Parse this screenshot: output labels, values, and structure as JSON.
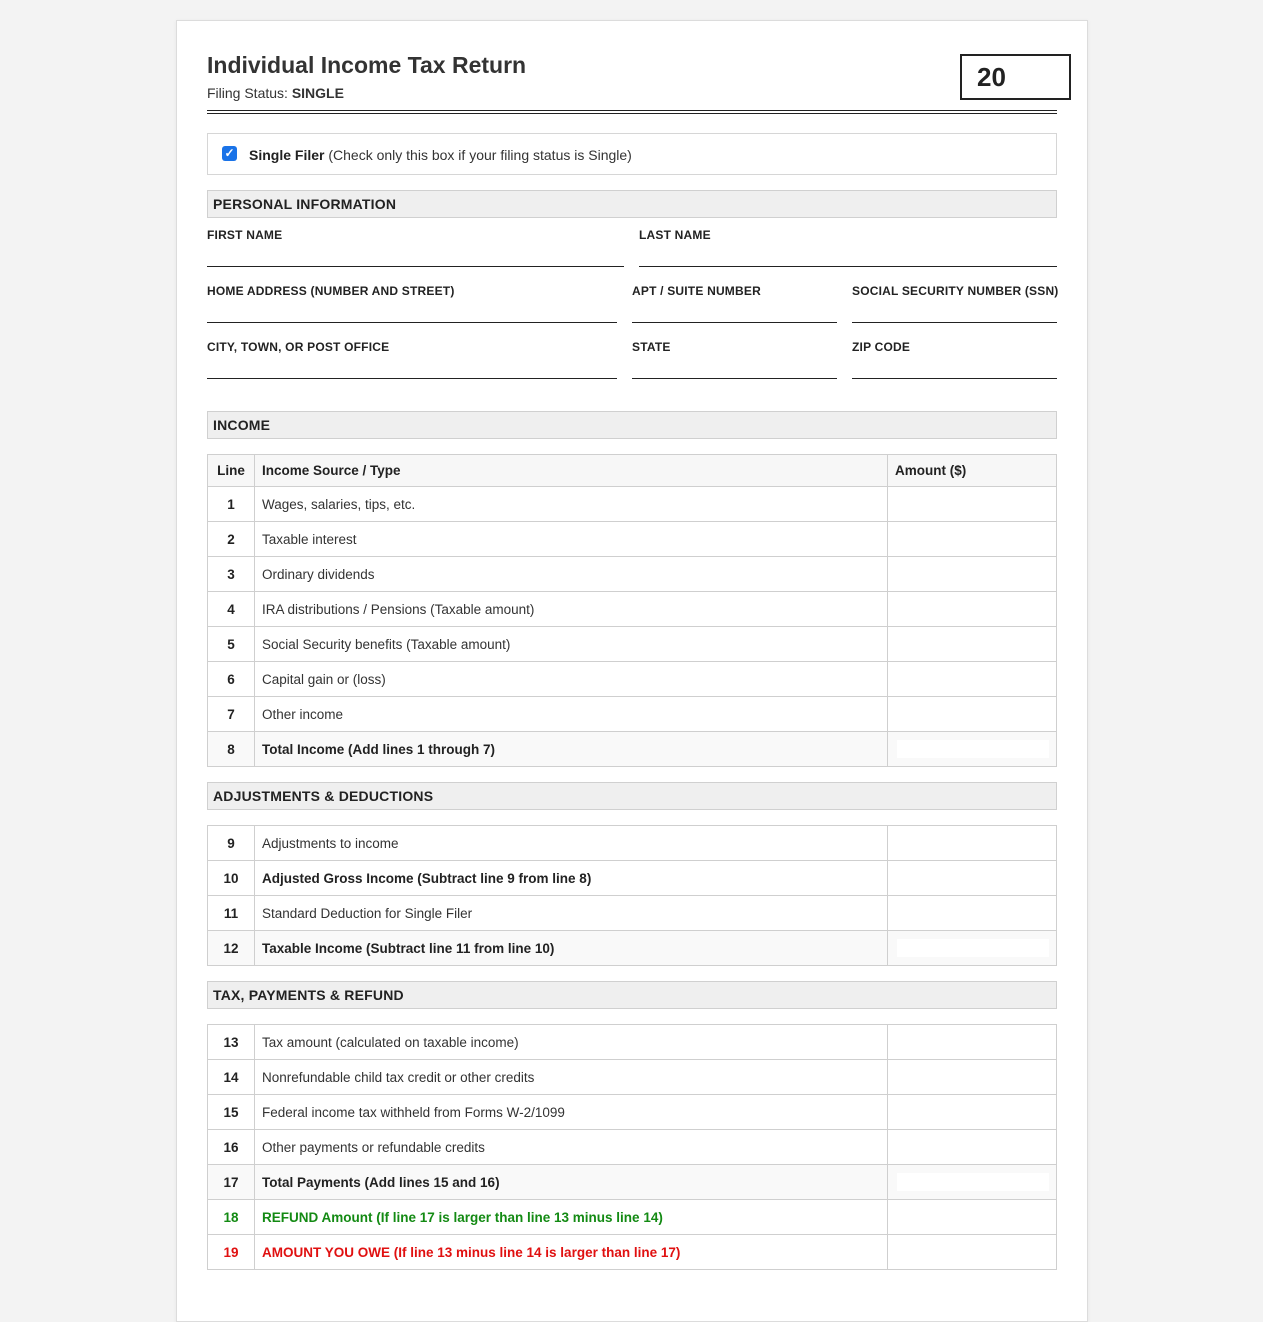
{
  "header": {
    "title": "Individual Income Tax Return",
    "filing_status_label": "Filing Status:",
    "filing_status_value": "SINGLE",
    "year": "20"
  },
  "filer": {
    "checked": true,
    "label_bold": "Single Filer",
    "label_note": "(Check only this box if your filing status is Single)"
  },
  "sections": {
    "personal": "PERSONAL INFORMATION",
    "income": "INCOME",
    "adjustments": "ADJUSTMENTS & DEDUCTIONS",
    "tax": "TAX, PAYMENTS & REFUND"
  },
  "personal_fields": {
    "first_name": "FIRST NAME",
    "last_name": "LAST NAME",
    "home_address": "HOME ADDRESS (NUMBER AND STREET)",
    "apt": "APT / SUITE NUMBER",
    "ssn": "SOCIAL SECURITY NUMBER (SSN)",
    "city": "CITY, TOWN, OR POST OFFICE",
    "state": "STATE",
    "zip": "ZIP CODE"
  },
  "income_table": {
    "headers": [
      "Line",
      "Income Source / Type",
      "Amount ($)"
    ],
    "rows": [
      {
        "line": "1",
        "desc": "Wages, salaries, tips, etc."
      },
      {
        "line": "2",
        "desc": "Taxable interest"
      },
      {
        "line": "3",
        "desc": "Ordinary dividends"
      },
      {
        "line": "4",
        "desc": "IRA distributions / Pensions (Taxable amount)"
      },
      {
        "line": "5",
        "desc": "Social Security benefits (Taxable amount)"
      },
      {
        "line": "6",
        "desc": "Capital gain or (loss)"
      },
      {
        "line": "7",
        "desc": "Other income"
      },
      {
        "line": "8",
        "desc": "Total Income (Add lines 1 through 7)"
      }
    ]
  },
  "adjust_table": {
    "rows": [
      {
        "line": "9",
        "desc": "Adjustments to income"
      },
      {
        "line": "10",
        "desc": "Adjusted Gross Income (Subtract line 9 from line 8)"
      },
      {
        "line": "11",
        "desc": "Standard Deduction for Single Filer"
      },
      {
        "line": "12",
        "desc": "Taxable Income (Subtract line 11 from line 10)"
      }
    ]
  },
  "tax_table": {
    "rows": [
      {
        "line": "13",
        "desc": "Tax amount (calculated on taxable income)"
      },
      {
        "line": "14",
        "desc": "Nonrefundable child tax credit or other credits"
      },
      {
        "line": "15",
        "desc": "Federal income tax withheld from Forms W-2/1099"
      },
      {
        "line": "16",
        "desc": "Other payments or refundable credits"
      },
      {
        "line": "17",
        "desc": "Total Payments (Add lines 15 and 16)"
      },
      {
        "line": "18",
        "desc": "REFUND Amount (If line 17 is larger than line 13 minus line 14)"
      },
      {
        "line": "19",
        "desc": "AMOUNT YOU OWE (If line 13 minus line 14 is larger than line 17)"
      }
    ]
  },
  "colors": {
    "checkbox": "#1a73e8",
    "refund": "#138a13",
    "owe": "#e01010"
  }
}
